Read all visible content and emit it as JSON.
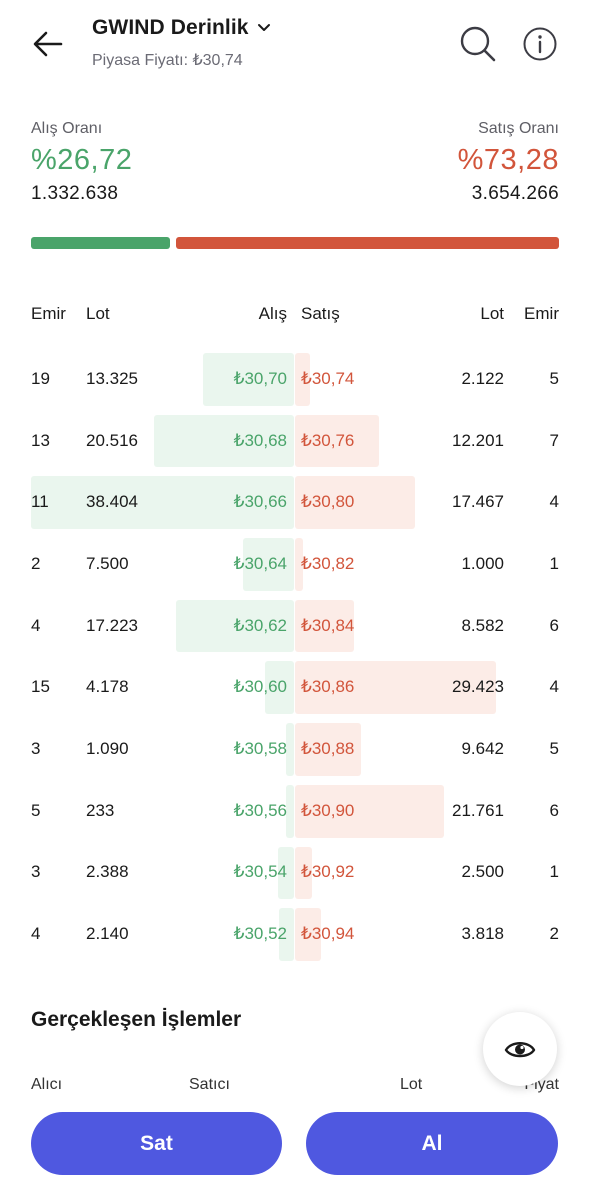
{
  "header": {
    "title": "GWIND Derinlik",
    "subtitle": "Piyasa Fiyatı: ₺30,74"
  },
  "ratio": {
    "buy_label": "Alış Oranı",
    "buy_pct": "%26,72",
    "buy_volume": "1.332.638",
    "sell_label": "Satış Oranı",
    "sell_pct": "%73,28",
    "sell_volume": "3.654.266",
    "buy_fraction": 0.2672,
    "buy_color": "#4aa46a",
    "sell_color": "#d2553b"
  },
  "depth": {
    "headers": {
      "emir_left": "Emir",
      "lot_left": "Lot",
      "bid": "Alış",
      "ask": "Satış",
      "lot_right": "Lot",
      "emir_right": "Emir"
    },
    "rows": [
      {
        "emir_l": "19",
        "lot_l": "13.325",
        "bid": "₺30,70",
        "ask": "₺30,74",
        "lot_r": "2.122",
        "emir_r": "5",
        "bid_lot": 13325,
        "ask_lot": 2122
      },
      {
        "emir_l": "13",
        "lot_l": "20.516",
        "bid": "₺30,68",
        "ask": "₺30,76",
        "lot_r": "12.201",
        "emir_r": "7",
        "bid_lot": 20516,
        "ask_lot": 12201
      },
      {
        "emir_l": "11",
        "lot_l": "38.404",
        "bid": "₺30,66",
        "ask": "₺30,80",
        "lot_r": "17.467",
        "emir_r": "4",
        "bid_lot": 38404,
        "ask_lot": 17467
      },
      {
        "emir_l": "2",
        "lot_l": "7.500",
        "bid": "₺30,64",
        "ask": "₺30,82",
        "lot_r": "1.000",
        "emir_r": "1",
        "bid_lot": 7500,
        "ask_lot": 1000
      },
      {
        "emir_l": "4",
        "lot_l": "17.223",
        "bid": "₺30,62",
        "ask": "₺30,84",
        "lot_r": "8.582",
        "emir_r": "6",
        "bid_lot": 17223,
        "ask_lot": 8582
      },
      {
        "emir_l": "15",
        "lot_l": "4.178",
        "bid": "₺30,60",
        "ask": "₺30,86",
        "lot_r": "29.423",
        "emir_r": "4",
        "bid_lot": 4178,
        "ask_lot": 29423
      },
      {
        "emir_l": "3",
        "lot_l": "1.090",
        "bid": "₺30,58",
        "ask": "₺30,88",
        "lot_r": "9.642",
        "emir_r": "5",
        "bid_lot": 1090,
        "ask_lot": 9642
      },
      {
        "emir_l": "5",
        "lot_l": "233",
        "bid": "₺30,56",
        "ask": "₺30,90",
        "lot_r": "21.761",
        "emir_r": "6",
        "bid_lot": 233,
        "ask_lot": 21761
      },
      {
        "emir_l": "3",
        "lot_l": "2.388",
        "bid": "₺30,54",
        "ask": "₺30,92",
        "lot_r": "2.500",
        "emir_r": "1",
        "bid_lot": 2388,
        "ask_lot": 2500
      },
      {
        "emir_l": "4",
        "lot_l": "2.140",
        "bid": "₺30,52",
        "ask": "₺30,94",
        "lot_r": "3.818",
        "emir_r": "2",
        "bid_lot": 2140,
        "ask_lot": 3818
      }
    ]
  },
  "trades": {
    "title": "Gerçekleşen İşlemler",
    "headers": {
      "buyer": "Alıcı",
      "seller": "Satıcı",
      "lot": "Lot",
      "price": "Fiyat"
    }
  },
  "icons": {
    "back": "arrow-left-icon",
    "dropdown": "chevron-down-icon",
    "search": "search-icon",
    "info": "info-icon",
    "eye": "eye-icon"
  },
  "actions": {
    "sell_label": "Sat",
    "buy_label": "Al",
    "button_color": "#4f58e0"
  }
}
